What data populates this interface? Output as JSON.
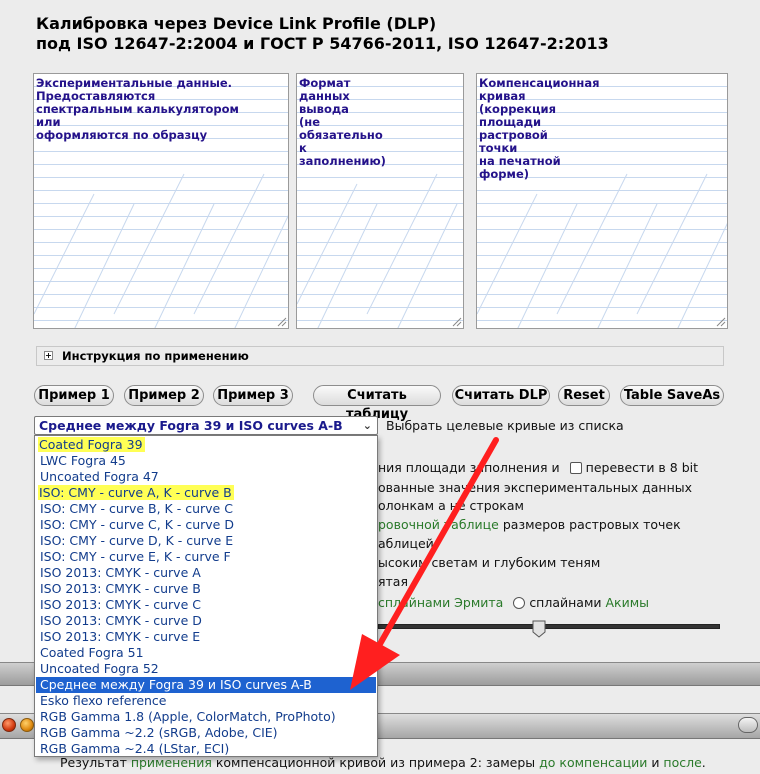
{
  "title": {
    "line1": "Калибровка через Device Link Profile (DLP)",
    "line2": "под ISO 12647-2:2004 и ГОСТ Р 54766-2011, ISO 12647-2:2013"
  },
  "panes": {
    "experimental": "Экспериментальные данные.\nПредоставляются\nспектральным калькулятором\nили\nоформляются по образцу",
    "output": "Формат\nданных\nвывода\n(не\nобязательно\nк\nзаполнению)",
    "compensation": "Компенсационная\nкривая\n(коррекция\nплощади\nрастровой\nточки\nна печатной\nформе)"
  },
  "instructions": {
    "label": "Инструкция по применению",
    "toggle": "+"
  },
  "buttons": {
    "example1": "Пример 1",
    "example2": "Пример 2",
    "example3": "Пример 3",
    "read_table": "Считать таблицу",
    "read_dlp": "Считать DLP",
    "reset": "Reset",
    "table_saveas": "Table SaveAs"
  },
  "select": {
    "value": "Среднее между Fogra 39 и ISO curves A-B",
    "hint": "Выбрать целевые кривые из списка",
    "options": [
      "Coated Fogra 39",
      "LWC Fogra 45",
      "Uncoated Fogra 47",
      "ISO: CMY - curve A, K - curve B",
      "ISO: CMY - curve B, K - curve C",
      "ISO: CMY - curve C, K - curve D",
      "ISO: CMY - curve D, K - curve E",
      "ISO: CMY - curve E, K - curve F",
      "ISO 2013: CMYK - curve A",
      "ISO 2013: CMYK - curve B",
      "ISO 2013: CMYK - curve C",
      "ISO 2013: CMYK - curve D",
      "ISO 2013: CMYK - curve E",
      "Coated Fogra 51",
      "Uncoated Fogra 52",
      "Среднее между Fogra 39 и ISO curves A-B",
      "Esko flexo reference",
      "RGB Gamma 1.8 (Apple, ColorMatch, ProPhoto)",
      "RGB Gamma ~2.2 (sRGB, Adobe, CIE)",
      "RGB Gamma ~2.4 (LStar, ECI)"
    ]
  },
  "background": {
    "line1a": "ния площади заполнения и",
    "line1b": "перевести в 8 bit",
    "line2": "ованные значения экспериментальных данных",
    "line3": "олонкам а не строкам",
    "line4a": "ровочной таблице",
    "line4b": " размеров растровых точек",
    "line5": "аблицей",
    "line6": "ысоким светам и глубоким теням",
    "line7": "ятая",
    "line8a": "сплайнами Эрмита",
    "line8b": "сплайнами ",
    "line8c": "Акимы"
  },
  "footer": {
    "p1": "Результат ",
    "p2": "применения",
    "p3": " компенсационной кривой из примера 2: замеры ",
    "p4": "до компенсации",
    "p5": " и ",
    "p6": "после",
    "p7": "."
  },
  "colors": {
    "highlight": "#ffff55",
    "selected": "#1e62d0",
    "pane_text": "#24128a",
    "arrow": "#ff1f1f",
    "link_green": "#2a7a2a"
  }
}
